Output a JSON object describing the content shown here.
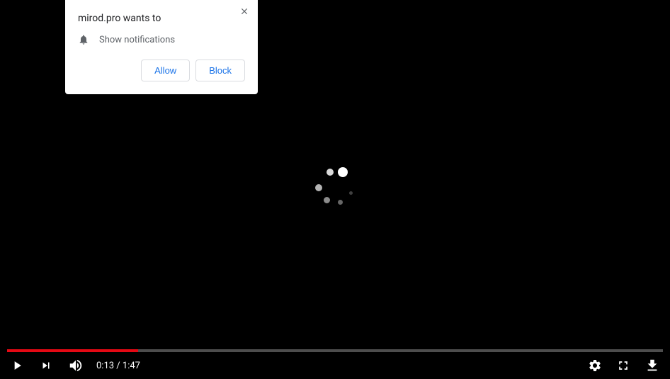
{
  "dialog": {
    "title": "mirod.pro wants to",
    "subtitle": "Show notifications",
    "allow_label": "Allow",
    "block_label": "Block"
  },
  "player": {
    "current_time": "0:13",
    "separator": " / ",
    "duration": "1:47",
    "progress_percent": 20
  }
}
